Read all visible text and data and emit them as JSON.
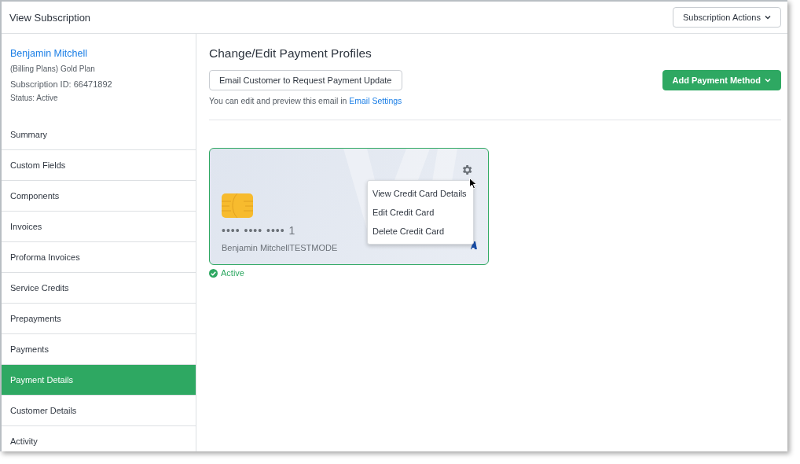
{
  "window": {
    "title": "View Subscription"
  },
  "header_actions": {
    "label": "Subscription Actions"
  },
  "customer": {
    "name": "Benjamin Mitchell",
    "plan": "(Billing Plans) Gold Plan",
    "subscription_id": "Subscription ID: 66471892",
    "status": "Status: Active"
  },
  "sidebar": {
    "items": [
      {
        "label": "Summary",
        "selected": false
      },
      {
        "label": "Custom Fields",
        "selected": false
      },
      {
        "label": "Components",
        "selected": false
      },
      {
        "label": "Invoices",
        "selected": false
      },
      {
        "label": "Proforma Invoices",
        "selected": false
      },
      {
        "label": "Service Credits",
        "selected": false
      },
      {
        "label": "Prepayments",
        "selected": false
      },
      {
        "label": "Payments",
        "selected": false
      },
      {
        "label": "Payment Details",
        "selected": true
      },
      {
        "label": "Customer Details",
        "selected": false
      },
      {
        "label": "Activity",
        "selected": false
      }
    ]
  },
  "main": {
    "title": "Change/Edit Payment Profiles",
    "email_button": "Email Customer to Request Payment Update",
    "add_button": "Add Payment Method",
    "hint": "You can edit and preview this email in ",
    "hint_link": "Email Settings"
  },
  "card": {
    "number": "•••• •••• •••• 1",
    "holder": "Benjamin MitchellTESTMODE",
    "status": "Active",
    "menu": {
      "items": [
        "View Credit Card Details",
        "Edit Credit Card",
        "Delete Credit Card"
      ]
    }
  }
}
